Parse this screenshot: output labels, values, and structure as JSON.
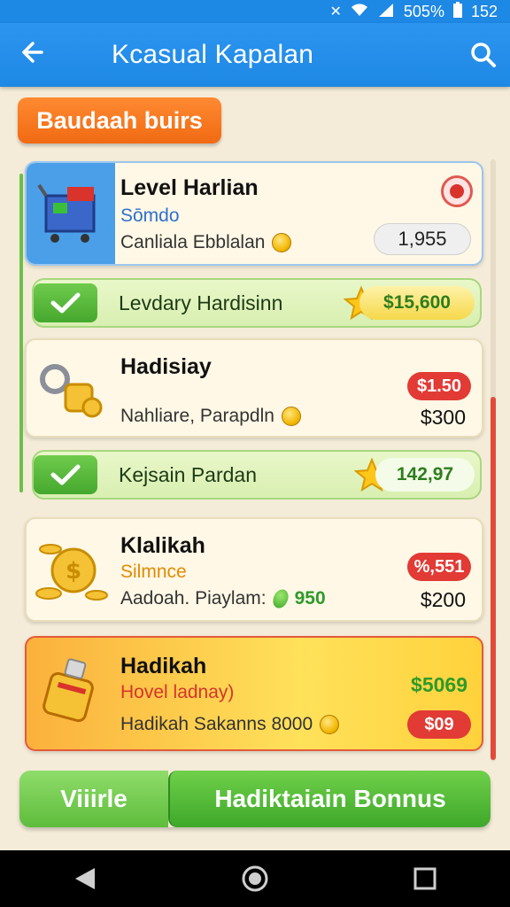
{
  "status_bar": {
    "battery": "505%",
    "time": "152"
  },
  "app_bar": {
    "title": "Kcasual Kapalan"
  },
  "section_tag": "Baudaah buirs",
  "cards": [
    {
      "name": "Level Harlian",
      "sub": "Sōmdo",
      "line": "Canliala Ebblalan",
      "pill": "1,955"
    },
    {
      "name": "Hadisiay",
      "line": "Nahliare, Parapdln",
      "red": "$1.50",
      "price": "$300"
    },
    {
      "name": "Klalikah",
      "sub": "Silmnce",
      "line": "Aadoah. Piaylam:",
      "gem_value": "950",
      "red": "%,551",
      "price": "$200"
    },
    {
      "name": "Hadikah",
      "sub": "Hovel ladnay)",
      "line": "Hadikah Sakanns 8000",
      "green": "$5069",
      "red": "$09"
    }
  ],
  "achievements": [
    {
      "label": "Levdary Hardisinn",
      "amount": "$15,600"
    },
    {
      "label": "Kejsain Pardan",
      "amount": "142,97"
    }
  ],
  "buttons": {
    "left": "Viiirle",
    "right": "Hadiktaiain Bonnus"
  },
  "colors": {
    "accent": "#1e88e5",
    "tag": "#f06a12",
    "green": "#45a82e",
    "red": "#e23a34"
  }
}
